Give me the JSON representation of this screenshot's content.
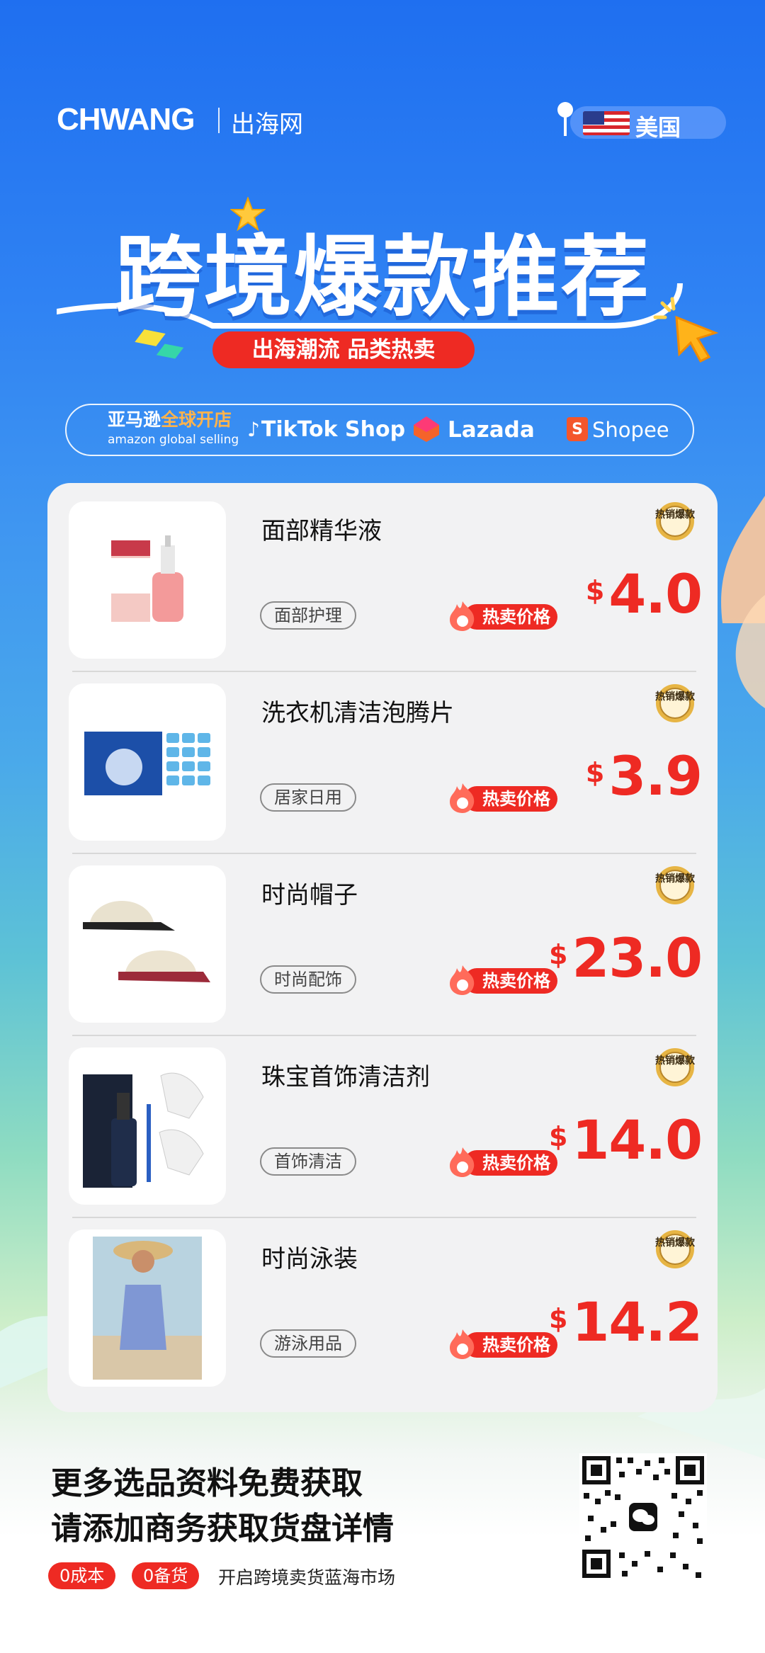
{
  "header": {
    "logo": "CHWANG",
    "logo_sub": "出海网",
    "country": "美国"
  },
  "hero": {
    "title": "跨境爆款推荐",
    "tagline": "出海潮流 品类热卖"
  },
  "platforms": {
    "amazon_cn_a": "亚马逊",
    "amazon_cn_b": "全球开店",
    "amazon_en": "amazon global selling",
    "tiktok": "TikTok Shop",
    "lazada": "Lazada",
    "shopee": "Shopee"
  },
  "products": [
    {
      "name": "面部精华液",
      "category": "面部护理",
      "hot_label": "热卖价格",
      "badge": "热销爆款",
      "currency": "$",
      "price": "4.0"
    },
    {
      "name": "洗衣机清洁泡腾片",
      "category": "居家日用",
      "hot_label": "热卖价格",
      "badge": "热销爆款",
      "currency": "$",
      "price": "3.9"
    },
    {
      "name": "时尚帽子",
      "category": "时尚配饰",
      "hot_label": "热卖价格",
      "badge": "热销爆款",
      "currency": "$",
      "price": "23.0"
    },
    {
      "name": "珠宝首饰清洁剂",
      "category": "首饰清洁",
      "hot_label": "热卖价格",
      "badge": "热销爆款",
      "currency": "$",
      "price": "14.0"
    },
    {
      "name": "时尚泳装",
      "category": "游泳用品",
      "hot_label": "热卖价格",
      "badge": "热销爆款",
      "currency": "$",
      "price": "14.2"
    }
  ],
  "footer": {
    "line1": "更多选品资料免费获取",
    "line2": "请添加商务获取货盘详情",
    "chip1": "0成本",
    "chip2": "0备货",
    "note": "开启跨境卖货蓝海市场"
  },
  "colors": {
    "accent_red": "#ee2a23",
    "bg_blue": "#1f6ff0"
  }
}
